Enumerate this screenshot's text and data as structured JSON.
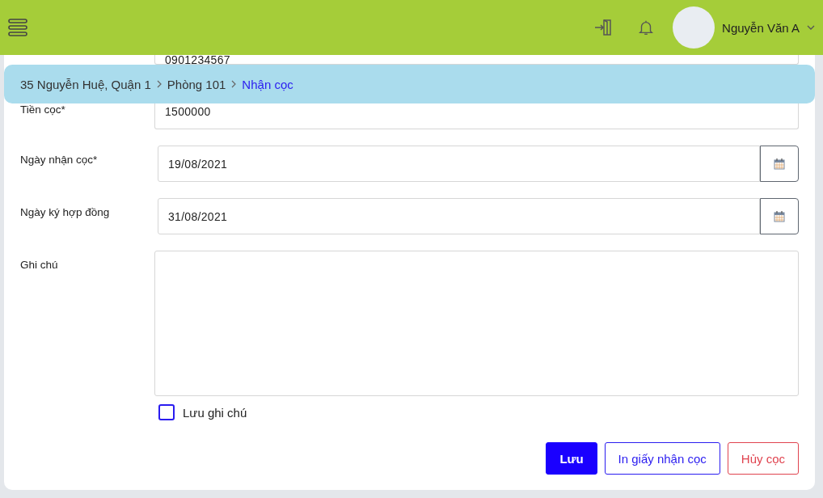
{
  "header": {
    "user_name": "Nguyễn Văn A"
  },
  "breadcrumb": [
    {
      "label": "35 Nguyễn Huệ, Quận 1",
      "current": false
    },
    {
      "label": "Phòng 101",
      "current": false
    },
    {
      "label": "Nhận cọc",
      "current": true
    }
  ],
  "form": {
    "fields": [
      {
        "kind": "text",
        "value": "0901234567"
      },
      {
        "kind": "text",
        "label": "Tiền cọc*",
        "value": "1500000"
      },
      {
        "kind": "date",
        "label": "Ngày nhận cọc*",
        "value": "19/08/2021"
      },
      {
        "kind": "date",
        "label": "Ngày ký hợp đồng",
        "value": "31/08/2021"
      },
      {
        "kind": "textarea",
        "label": "Ghi chú"
      }
    ],
    "save_note": {
      "label": "Lưu ghi chú",
      "checked": false
    },
    "buttons": [
      {
        "kind": "primary",
        "label": "Lưu"
      },
      {
        "kind": "outline",
        "label": "In giấy nhận cọc"
      },
      {
        "kind": "danger",
        "label": "Hủy cọc"
      }
    ]
  }
}
